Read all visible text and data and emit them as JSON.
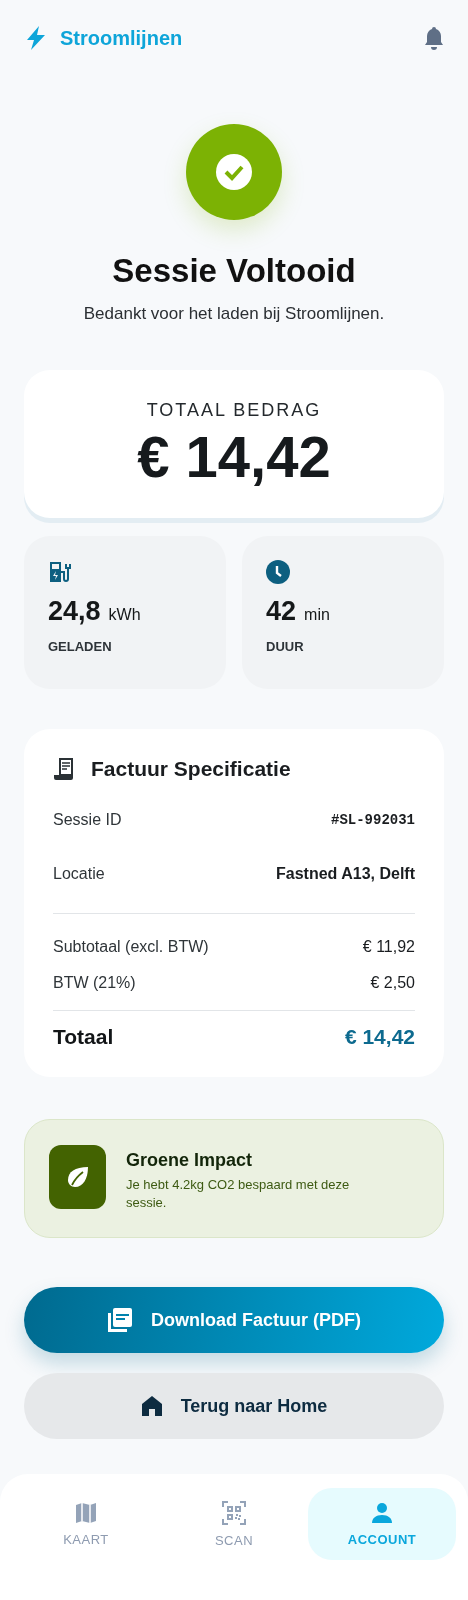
{
  "header": {
    "brand": "Stroomlijnen"
  },
  "hero": {
    "title": "Sessie Voltooid",
    "subtitle": "Bedankt voor het laden bij Stroomlijnen."
  },
  "total": {
    "label": "TOTAAL BEDRAG",
    "amount": "€ 14,42"
  },
  "stats": [
    {
      "kind": "energy",
      "value": "24,8",
      "unit": "kWh",
      "label": "GELADEN"
    },
    {
      "kind": "time",
      "value": "42",
      "unit": "min",
      "label": "DUUR"
    }
  ],
  "invoice": {
    "title": "Factuur Specificatie",
    "details": [
      {
        "kind": "mono",
        "label": "Sessie ID",
        "value": "#SL-992031"
      },
      {
        "kind": "bold",
        "label": "Locatie",
        "value": "Fastned A13, Delft"
      }
    ],
    "costs": [
      {
        "label": "Subtotaal (excl. BTW)",
        "value": "€ 11,92"
      },
      {
        "label": "BTW (21%)",
        "value": "€ 2,50"
      }
    ],
    "total": {
      "label": "Totaal",
      "value": "€ 14,42"
    }
  },
  "impact": {
    "title": "Groene Impact",
    "text": "Je hebt 4.2kg CO2 bespaard met deze sessie."
  },
  "actions": [
    {
      "kind": "primary",
      "label": "Download Factuur (PDF)"
    },
    {
      "kind": "secondary",
      "label": "Terug naar Home"
    }
  ],
  "nav": [
    {
      "kind": "map",
      "label": "KAART",
      "selected": false
    },
    {
      "kind": "scan",
      "label": "SCAN",
      "selected": false
    },
    {
      "kind": "account",
      "label": "ACCOUNT",
      "selected": true
    }
  ]
}
